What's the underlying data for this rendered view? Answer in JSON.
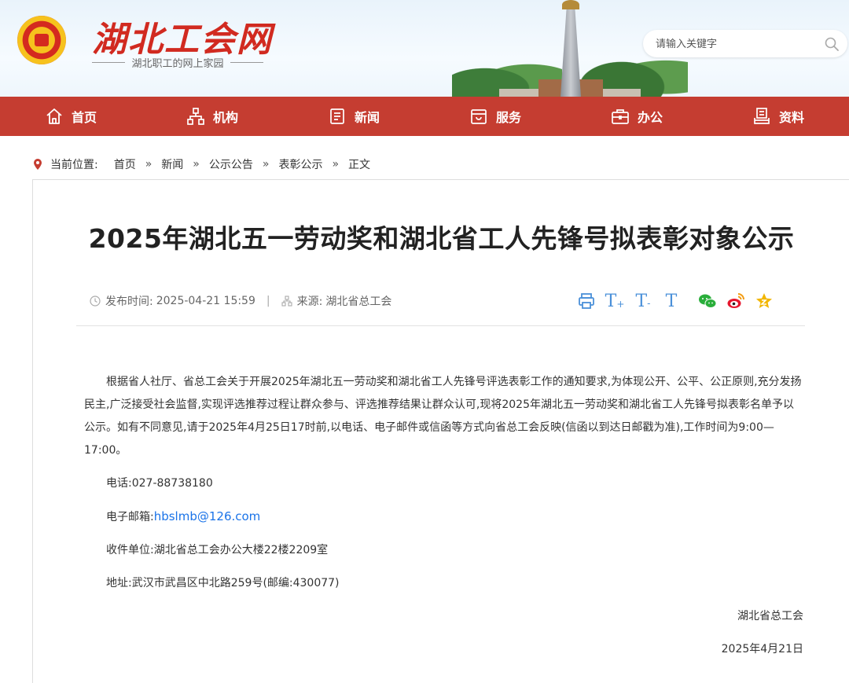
{
  "header": {
    "logo_text": "湖北工会网",
    "logo_sub": "湖北职工的网上家园",
    "search_placeholder": "请输入关键字"
  },
  "nav": {
    "items": [
      {
        "label": "首页",
        "icon": "home-icon"
      },
      {
        "label": "机构",
        "icon": "org-chart-icon"
      },
      {
        "label": "新闻",
        "icon": "news-icon"
      },
      {
        "label": "服务",
        "icon": "service-icon"
      },
      {
        "label": "办公",
        "icon": "briefcase-icon"
      },
      {
        "label": "资料",
        "icon": "archive-icon"
      }
    ]
  },
  "breadcrumb": {
    "label": "当前位置:",
    "items": [
      "首页",
      "新闻",
      "公示公告",
      "表彰公示",
      "正文"
    ],
    "separator": "»"
  },
  "article": {
    "title": "2025年湖北五一劳动奖和湖北省工人先锋号拟表彰对象公示",
    "publish_label": "发布时间:",
    "publish_time": "2025-04-21 15:59",
    "source_label": "来源:",
    "source": "湖北省总工会",
    "paragraph": "根据省人社厅、省总工会关于开展2025年湖北五一劳动奖和湖北省工人先锋号评选表彰工作的通知要求,为体现公开、公平、公正原则,充分发扬民主,广泛接受社会监督,实现评选推荐过程让群众参与、评选推荐结果让群众认可,现将2025年湖北五一劳动奖和湖北省工人先锋号拟表彰名单予以公示。如有不同意见,请于2025年4月25日17时前,以电话、电子邮件或信函等方式向省总工会反映(信函以到达日邮戳为准),工作时间为9:00—17:00。",
    "phone": "电话:027-88738180",
    "email_label": "电子邮箱:",
    "email": "hbslmb@126.com",
    "recipient": "收件单位:湖北省总工会办公大楼22楼2209室",
    "address": "地址:武汉市武昌区中北路259号(邮编:430077)",
    "signature": "湖北省总工会",
    "date": "2025年4月21日"
  },
  "tools": {
    "font_labels": [
      "T",
      "T",
      "T"
    ]
  },
  "colors": {
    "nav_bg": "#c53d31",
    "logo_red": "#d12a20",
    "link_blue": "#1a73e8",
    "tool_blue": "#4a90d9",
    "wechat_green": "#2aae3b",
    "weibo_orange": "#e6162d",
    "star_gold": "#f2b600"
  }
}
